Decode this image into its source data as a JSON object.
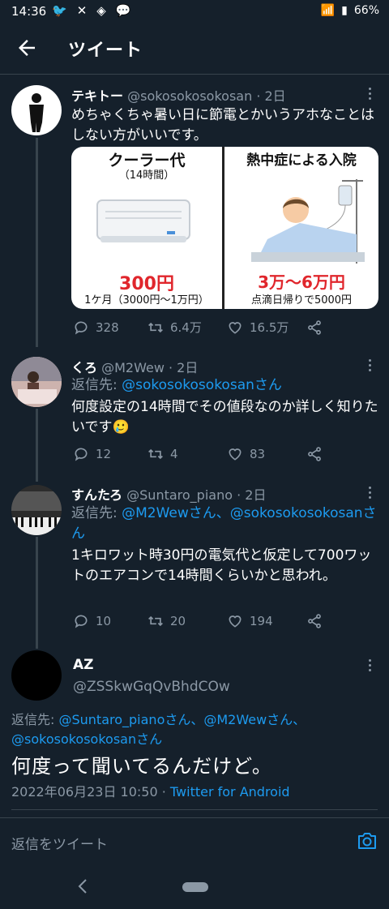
{
  "status_bar": {
    "time": "14:36",
    "battery": "66%"
  },
  "app_bar": {
    "title": "ツイート"
  },
  "tweets": [
    {
      "name": "テキトー",
      "handle": "@sokosokosokosan",
      "time": "· 2日",
      "text": "めちゃくちゃ暑い日に節電とかいうアホなことはしない方がいいです。",
      "image": {
        "left_title": "クーラー代",
        "left_subtitle": "（14時間）",
        "left_price": "300円",
        "left_note": "1ケ月（3000円～1万円）",
        "right_title": "熱中症による入院",
        "right_price": "3万～6万円",
        "right_note": "点滴日帰りで5000円"
      },
      "replies": "328",
      "retweets": "6.4万",
      "likes": "16.5万"
    },
    {
      "name": "くろ",
      "handle": "@M2Wew",
      "time": "· 2日",
      "reply_prefix": "返信先: ",
      "reply_to": "@sokosokosokosanさん",
      "text": "何度設定の14時間でその値段なのか詳しく知りたいです🥲",
      "replies": "12",
      "retweets": "4",
      "likes": "83"
    },
    {
      "name": "すんたろ",
      "handle": "@Suntaro_piano",
      "time": "· 2日",
      "reply_prefix": "返信先: ",
      "reply_to": "@M2Wewさん、@sokosokosokosanさん",
      "text": "1キロワット時30円の電気代と仮定して700ワットのエアコンで14時間くらいかと思われ。",
      "replies": "10",
      "retweets": "20",
      "likes": "194"
    }
  ],
  "focus_tweet": {
    "name": "AZ",
    "handle": "@ZSSkwGqQvBhdCOw",
    "reply_prefix": "返信先: ",
    "reply_to": "@Suntaro_pianoさん、@M2Wewさん、@sokosokosokosanさん",
    "text": "何度って聞いてるんだけど。",
    "datetime": "2022年06月23日 10:50 · ",
    "source": "Twitter for Android"
  },
  "reply_bar": {
    "placeholder": "返信をツイート"
  },
  "colors": {
    "background": "#15202b",
    "accent": "#1d9bf0",
    "muted": "#8b98a5"
  }
}
